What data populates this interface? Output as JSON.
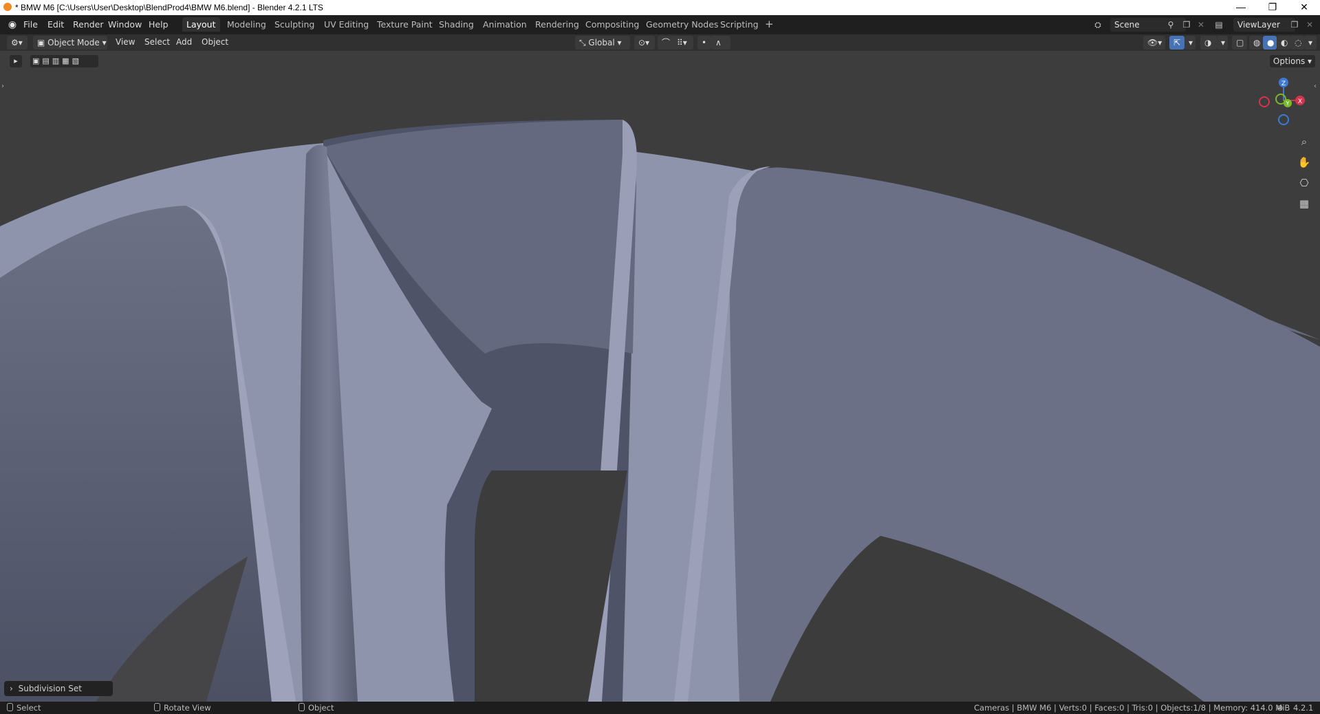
{
  "window": {
    "title": "* BMW M6 [C:\\Users\\User\\Desktop\\BlendProd4\\BMW M6.blend] - Blender 4.2.1 LTS",
    "minimize": "—",
    "maximize": "❐",
    "close": "✕"
  },
  "menubar": {
    "items": [
      "File",
      "Edit",
      "Render",
      "Window",
      "Help"
    ]
  },
  "workspaces": {
    "tabs": [
      "Layout",
      "Modeling",
      "Sculpting",
      "UV Editing",
      "Texture Paint",
      "Shading",
      "Animation",
      "Rendering",
      "Compositing",
      "Geometry Nodes",
      "Scripting"
    ],
    "active": "Layout",
    "add": "+"
  },
  "scene": {
    "name": "Scene"
  },
  "view_layer": {
    "name": "ViewLayer"
  },
  "viewport_header": {
    "mode": "Object Mode",
    "menus": [
      "View",
      "Select",
      "Add",
      "Object"
    ],
    "orientation": "Global"
  },
  "options_label": "Options",
  "gizmo": {
    "z": "Z",
    "y": "Y",
    "x": "X"
  },
  "redo_panel": {
    "label": "Subdivision Set"
  },
  "statusbar": {
    "select": "Select",
    "rotate": "Rotate View",
    "object": "Object",
    "stats": "Cameras | BMW M6 | Verts:0 | Faces:0 | Tris:0 | Objects:1/8 | Memory: 414.0 MiB",
    "version": "4.2.1"
  },
  "icons": [
    "blender-logo-icon",
    "editor-type-icon",
    "pin-icon",
    "new-scene-icon",
    "search-icon",
    "hand-icon",
    "camera-icon",
    "grid-icon"
  ]
}
